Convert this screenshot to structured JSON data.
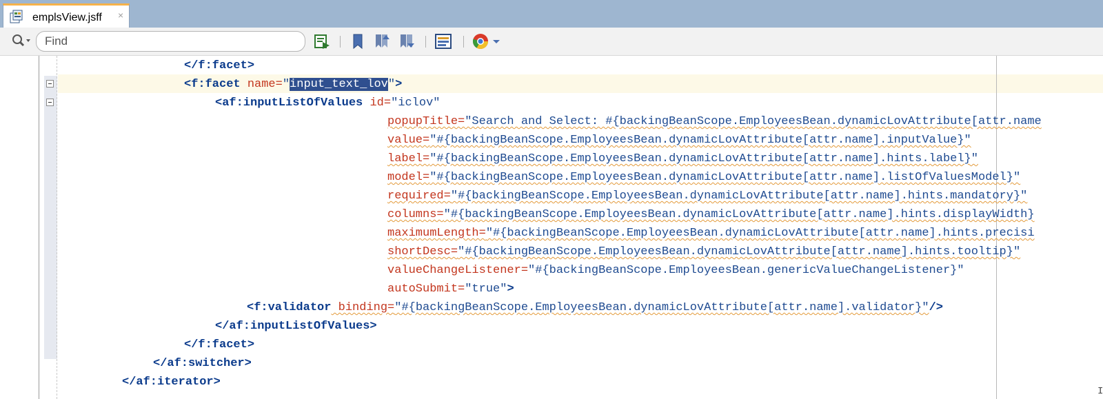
{
  "tab": {
    "title": "emplsView.jsff",
    "close": "×"
  },
  "toolbar": {
    "search_placeholder": "Find",
    "buttons": [
      "find-selection-icon",
      "toggle-bookmark-icon",
      "previous-bookmark-icon",
      "next-bookmark-icon",
      "toggle-highlight-icon",
      "browser-preview-icon",
      "dropdown-arrow-icon"
    ]
  },
  "code": {
    "l1": {
      "tag": "</f:facet>"
    },
    "l2": {
      "open": "<f:facet",
      "attr": " name=",
      "q1": "\"",
      "sel": "input_text_lov",
      "q2": "\"",
      "close": ">"
    },
    "l3": {
      "open": "<af:inputListOfValues",
      "attr": " id=",
      "val": "\"iclov\""
    },
    "l4": {
      "attr": "popupTitle=",
      "val": "\"Search and Select: #{backingBeanScope.EmployeesBean.dynamicLovAttribute[attr.name"
    },
    "l5": {
      "attr": "value=",
      "val": "\"#{backingBeanScope.EmployeesBean.dynamicLovAttribute[attr.name].inputValue}\""
    },
    "l6": {
      "attr": "label=",
      "val": "\"#{backingBeanScope.EmployeesBean.dynamicLovAttribute[attr.name].hints.label}\""
    },
    "l7": {
      "attr": "model=",
      "val": "\"#{backingBeanScope.EmployeesBean.dynamicLovAttribute[attr.name].listOfValuesModel}\""
    },
    "l8": {
      "attr": "required=",
      "val": "\"#{backingBeanScope.EmployeesBean.dynamicLovAttribute[attr.name].hints.mandatory}\""
    },
    "l9": {
      "attr": "columns=",
      "val": "\"#{backingBeanScope.EmployeesBean.dynamicLovAttribute[attr.name].hints.displayWidth}"
    },
    "l10": {
      "attr": "maximumLength=",
      "val": "\"#{backingBeanScope.EmployeesBean.dynamicLovAttribute[attr.name].hints.precisi"
    },
    "l11": {
      "attr": "shortDesc=",
      "val": "\"#{backingBeanScope.EmployeesBean.dynamicLovAttribute[attr.name].hints.tooltip}\""
    },
    "l12": {
      "attr": "valueChangeListener=",
      "val": "\"#{backingBeanScope.EmployeesBean.genericValueChangeListener}\""
    },
    "l13": {
      "attr": "autoSubmit=",
      "val": "\"true\"",
      "close": ">"
    },
    "l14": {
      "open": "<f:validator",
      "attr": " binding=",
      "val": "\"#{backingBeanScope.EmployeesBean.dynamicLovAttribute[attr.name].validator}\"",
      "close": "/>"
    },
    "l15": {
      "tag": "</af:inputListOfValues>"
    },
    "l16": {
      "tag": "</f:facet>"
    },
    "l17": {
      "tag": "</af:switcher>"
    },
    "l18": {
      "tag": "</af:iterator>"
    }
  },
  "cursor_glyph": "I"
}
